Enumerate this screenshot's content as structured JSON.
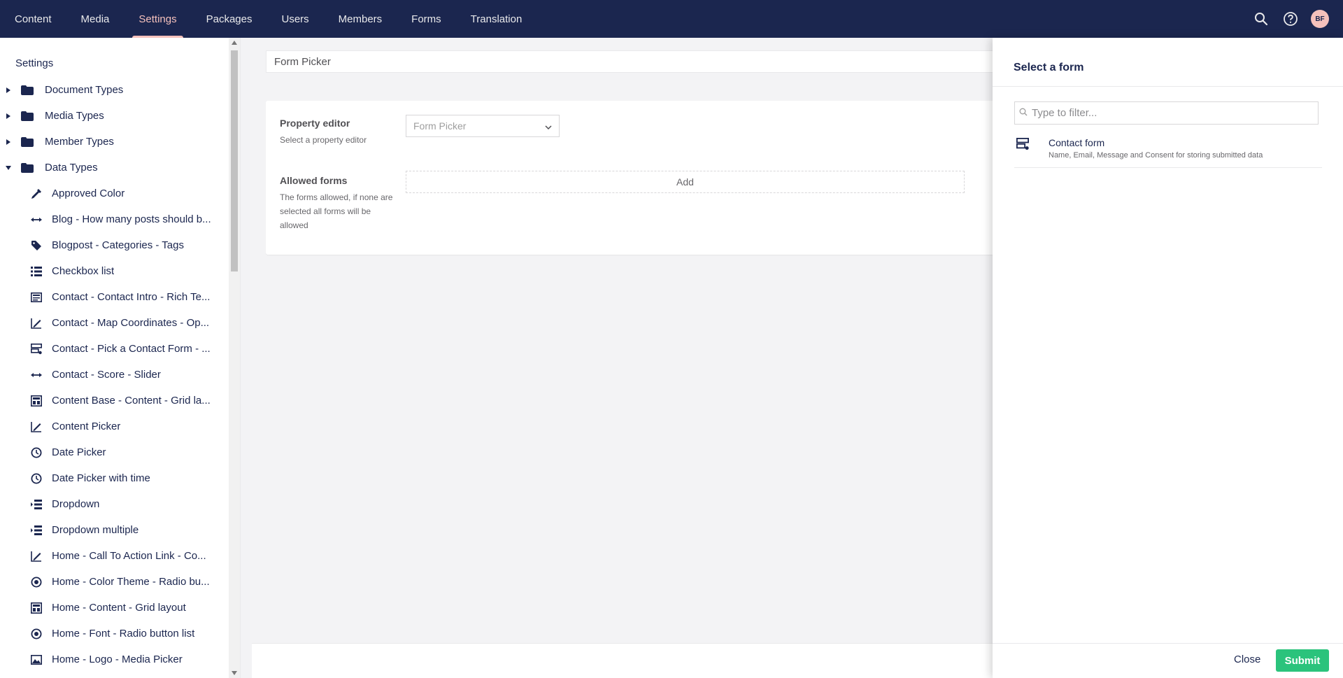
{
  "topnav": {
    "sections": [
      "Content",
      "Media",
      "Settings",
      "Packages",
      "Users",
      "Members",
      "Forms",
      "Translation"
    ],
    "active_section": "Settings",
    "avatar_initials": "BF"
  },
  "tree": {
    "root_title": "Settings",
    "folders": [
      {
        "label": "Document Types",
        "expanded": false
      },
      {
        "label": "Media Types",
        "expanded": false
      },
      {
        "label": "Member Types",
        "expanded": false
      },
      {
        "label": "Data Types",
        "expanded": true
      }
    ],
    "data_types": [
      {
        "label": "Approved Color",
        "icon": "eyedropper-icon"
      },
      {
        "label": "Blog - How many posts should b...",
        "icon": "arrows-horizontal-icon"
      },
      {
        "label": "Blogpost - Categories - Tags",
        "icon": "tag-icon"
      },
      {
        "label": "Checkbox list",
        "icon": "list-icon"
      },
      {
        "label": "Contact - Contact Intro - Rich Te...",
        "icon": "rich-text-icon"
      },
      {
        "label": "Contact - Map Coordinates - Op...",
        "icon": "edit-chart-icon"
      },
      {
        "label": "Contact - Pick a Contact Form - ...",
        "icon": "form-icon"
      },
      {
        "label": "Contact - Score - Slider",
        "icon": "arrows-horizontal-icon"
      },
      {
        "label": "Content Base - Content - Grid la...",
        "icon": "grid-layout-icon"
      },
      {
        "label": "Content Picker",
        "icon": "edit-chart-icon"
      },
      {
        "label": "Date Picker",
        "icon": "clock-icon"
      },
      {
        "label": "Date Picker with time",
        "icon": "clock-icon"
      },
      {
        "label": "Dropdown",
        "icon": "indent-list-icon"
      },
      {
        "label": "Dropdown multiple",
        "icon": "indent-list-icon"
      },
      {
        "label": "Home - Call To Action Link - Co...",
        "icon": "edit-chart-icon"
      },
      {
        "label": "Home - Color Theme - Radio bu...",
        "icon": "radio-icon"
      },
      {
        "label": "Home - Content - Grid layout",
        "icon": "grid-layout-icon"
      },
      {
        "label": "Home - Font - Radio button list",
        "icon": "radio-icon"
      },
      {
        "label": "Home - Logo - Media Picker",
        "icon": "image-icon"
      }
    ]
  },
  "editor": {
    "name_value": "Form Picker",
    "property_editor_label": "Property editor",
    "property_editor_desc": "Select a property editor",
    "property_editor_value": "Form Picker",
    "allowed_forms_label": "Allowed forms",
    "allowed_forms_desc": "The forms allowed, if none are selected all forms will be allowed",
    "add_label": "Add"
  },
  "overlay": {
    "title": "Select a form",
    "filter_placeholder": "Type to filter...",
    "forms": [
      {
        "name": "Contact form",
        "description": "Name, Email, Message and Consent for storing submitted data"
      }
    ],
    "close_label": "Close",
    "submit_label": "Submit",
    "submit_color": "#2bc37c"
  },
  "colors": {
    "nav_bg": "#1b264f",
    "nav_active": "#f5c1bc"
  }
}
